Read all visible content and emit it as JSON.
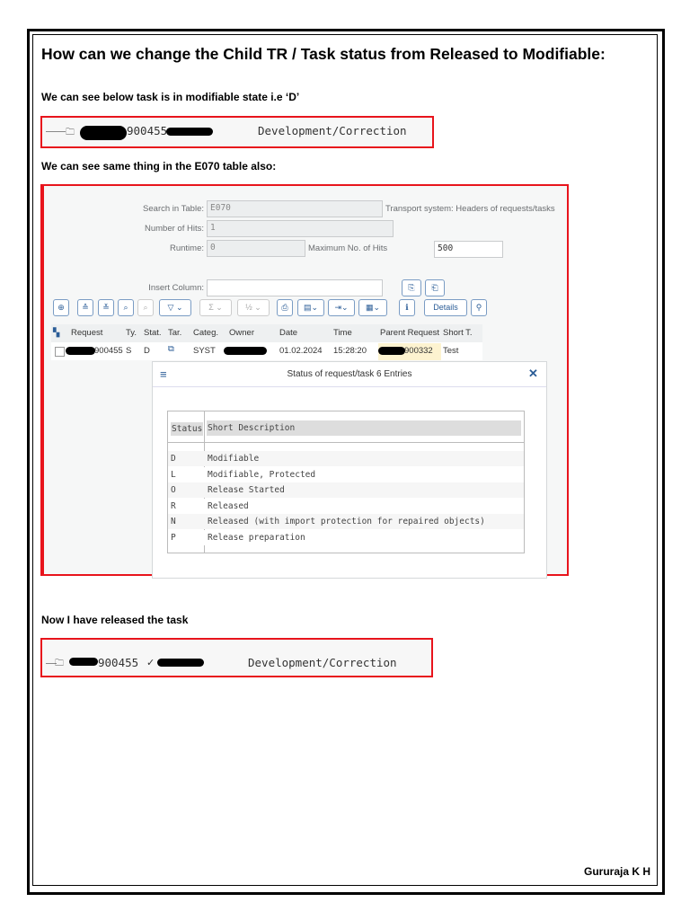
{
  "title": "How can we change the Child TR / Task status from Released to Modifiable:",
  "note1": "We can see below task is in modifiable state i.e ‘D’",
  "note2": "We can see same thing in the E070 table also:",
  "note3": "Now I have released the task",
  "footer": "Gururaja K H",
  "shot1": {
    "request": "900455",
    "description": "Development/Correction"
  },
  "shot3": {
    "request": "900455",
    "check": "✓",
    "description": "Development/Correction"
  },
  "se16": {
    "search_label": "Search in Table:",
    "search_value": "E070",
    "table_desc": "Transport system: Headers of requests/tasks",
    "hits_label": "Number of Hits:",
    "hits_value": "1",
    "runtime_label": "Runtime:",
    "runtime_value": "0",
    "max_label": "Maximum No. of Hits",
    "max_value": "500",
    "insert_label": "Insert Column:",
    "insert_value": "",
    "details_label": "Details",
    "columns": [
      "Request",
      "Ty.",
      "Stat.",
      "Tar.",
      "Categ.",
      "Owner",
      "Date",
      "Time",
      "Parent Request",
      "Short T."
    ],
    "row": {
      "request": "900455",
      "type": "S",
      "status": "D",
      "category": "SYST",
      "date": "01.02.2024",
      "time": "15:28:20",
      "parent": "900332",
      "short": "Test"
    }
  },
  "dialog": {
    "title": "Status of request/task 6 Entries",
    "col_status": "Status",
    "col_desc": "Short Description",
    "rows": [
      {
        "code": "D",
        "desc": "Modifiable"
      },
      {
        "code": "L",
        "desc": "Modifiable, Protected"
      },
      {
        "code": "O",
        "desc": "Release Started"
      },
      {
        "code": "R",
        "desc": "Released"
      },
      {
        "code": "N",
        "desc": "Released (with import protection for repaired objects)"
      },
      {
        "code": "P",
        "desc": "Release preparation"
      }
    ]
  }
}
